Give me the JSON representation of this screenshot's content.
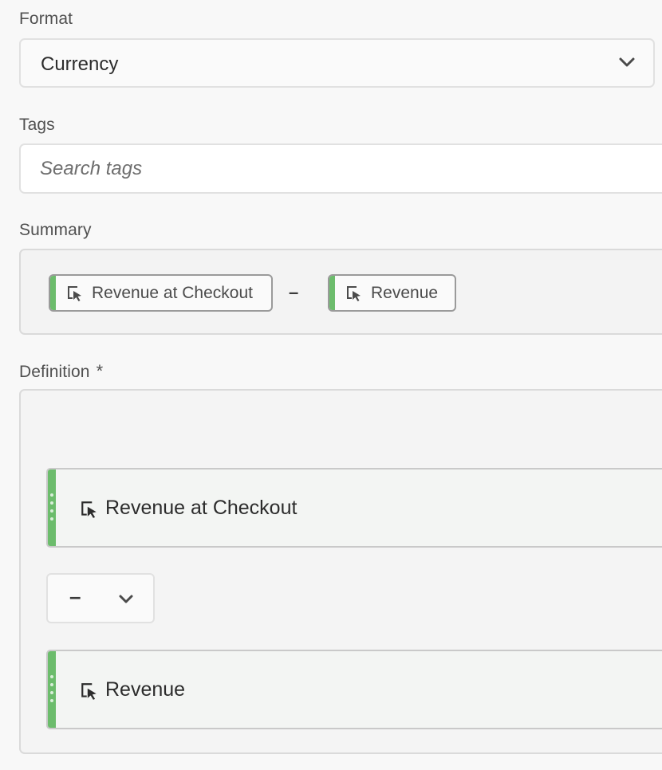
{
  "format": {
    "label": "Format",
    "selected_value": "Currency",
    "chevron_icon": "chevron-down-icon"
  },
  "tags": {
    "label": "Tags",
    "placeholder": "Search tags"
  },
  "summary": {
    "label": "Summary",
    "chips": [
      {
        "label": "Revenue at Checkout",
        "icon": "metric-cursor-icon",
        "accent_color": "#6cbc6c"
      },
      {
        "label": "Revenue",
        "icon": "metric-cursor-icon",
        "accent_color": "#6cbc6c"
      }
    ],
    "operator": "–"
  },
  "definition": {
    "label": "Definition",
    "required_marker": "*",
    "components": [
      {
        "label": "Revenue at Checkout",
        "icon": "metric-cursor-icon"
      },
      {
        "label": "Revenue",
        "icon": "metric-cursor-icon"
      }
    ],
    "operator": {
      "symbol": "–",
      "chevron_icon": "chevron-down-icon"
    }
  },
  "colors": {
    "metric_accent": "#6cbc6c"
  }
}
